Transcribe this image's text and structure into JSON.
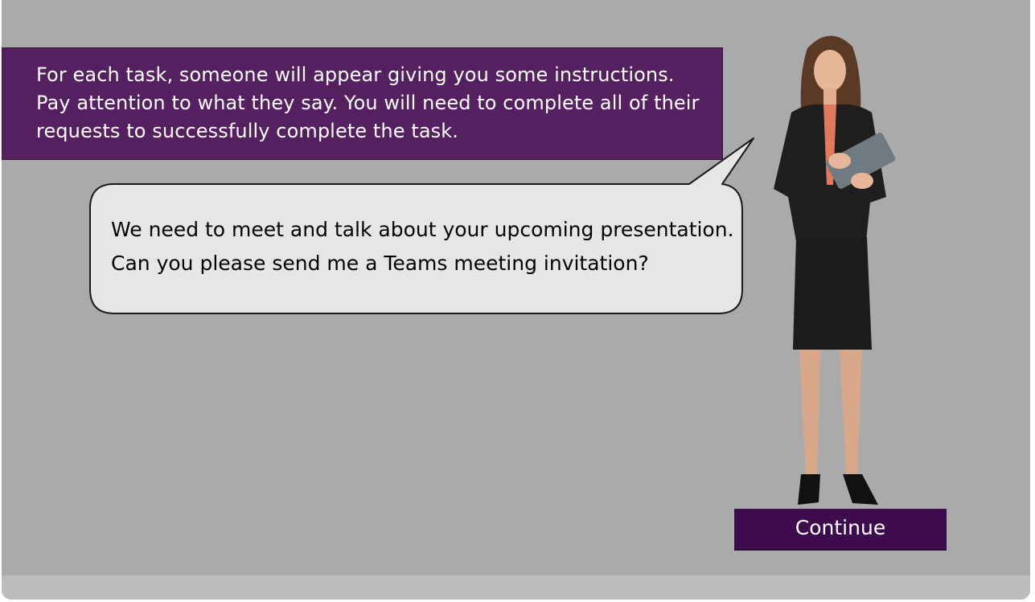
{
  "instruction": {
    "text": "For each task, someone will appear giving you some instructions. Pay attention to what they say. You will need to complete all of their requests to successfully complete the task."
  },
  "speech_bubble": {
    "line1": "We need to meet and talk about your upcoming presentation.",
    "line2": "Can you please send me a Teams meeting invitation?"
  },
  "actions": {
    "continue_label": "Continue"
  },
  "colors": {
    "background": "#aaaaaa",
    "instruction_box": "#55205f",
    "continue_button": "#3e0b4c",
    "bubble_fill": "#e6e6e6"
  }
}
